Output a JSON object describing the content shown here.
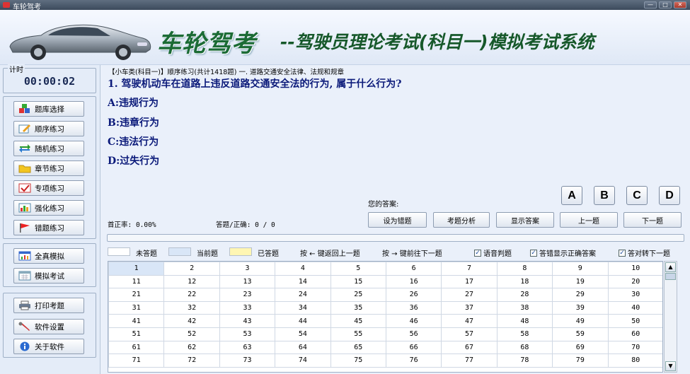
{
  "window": {
    "title": "车轮驾考",
    "controls": [
      "—",
      "□",
      "✕"
    ]
  },
  "banner": {
    "brand": "车轮驾考",
    "subtitle": "--驾驶员理论考试(科目一)模拟考试系统"
  },
  "timer": {
    "label": "计时",
    "value": "00:00:02"
  },
  "sidebar": {
    "group1": [
      {
        "label": "题库选择",
        "icon": "cubes-icon"
      },
      {
        "label": "顺序练习",
        "icon": "pencil-icon"
      },
      {
        "label": "随机练习",
        "icon": "shuffle-arrows-icon"
      },
      {
        "label": "章节练习",
        "icon": "folder-icon"
      },
      {
        "label": "专项练习",
        "icon": "checkmark-icon"
      },
      {
        "label": "强化练习",
        "icon": "bar-chart-icon"
      },
      {
        "label": "错题练习",
        "icon": "flag-icon"
      }
    ],
    "group2": [
      {
        "label": "全真模拟",
        "icon": "chart-window-icon"
      },
      {
        "label": "模拟考试",
        "icon": "calendar-icon"
      }
    ],
    "group3": [
      {
        "label": "打印考题",
        "icon": "printer-icon"
      },
      {
        "label": "软件设置",
        "icon": "wrench-icon"
      },
      {
        "label": "关于软件",
        "icon": "info-icon"
      }
    ]
  },
  "question": {
    "breadcrumb": "【小车类(科目一)】顺序练习(共计1418题) 一. 道路交通安全法律、法规和规章",
    "text": "1. 驾驶机动车在道路上违反道路交通安全法的行为, 属于什么行为?",
    "options": [
      "A:违规行为",
      "B:违章行为",
      "C:违法行为",
      "D:过失行为"
    ]
  },
  "answer": {
    "label": "您的答案:",
    "value": "",
    "buttons": [
      "A",
      "B",
      "C",
      "D"
    ]
  },
  "stats": {
    "accuracy": "首正率: 0.00%",
    "answered": "答题/正确: 0 / 0"
  },
  "actions": [
    "设为错题",
    "考题分析",
    "显示答案",
    "上一题",
    "下一题"
  ],
  "progress": {
    "fraction": 0.0
  },
  "legend": {
    "unanswered": "未答题",
    "current": "当前题",
    "answered": "已答题",
    "hint_left": "按 ← 键返回上一题",
    "hint_right": "按 → 键前往下一题",
    "checks": [
      {
        "label": "语音判题",
        "checked": true
      },
      {
        "label": "答错显示正确答案",
        "checked": true
      },
      {
        "label": "答对转下一题",
        "checked": true
      }
    ]
  },
  "colors": {
    "unanswered": "#ffffff",
    "current": "#d9e6f7",
    "answered": "#fff6b3"
  },
  "grid": {
    "rows": [
      [
        "1",
        "2",
        "3",
        "4",
        "5",
        "6",
        "7",
        "8",
        "9",
        "10"
      ],
      [
        "11",
        "12",
        "13",
        "14",
        "15",
        "16",
        "17",
        "18",
        "19",
        "20"
      ],
      [
        "21",
        "22",
        "23",
        "24",
        "25",
        "26",
        "27",
        "28",
        "29",
        "30"
      ],
      [
        "31",
        "32",
        "33",
        "34",
        "35",
        "36",
        "37",
        "38",
        "39",
        "40"
      ],
      [
        "41",
        "42",
        "43",
        "44",
        "45",
        "46",
        "47",
        "48",
        "49",
        "50"
      ],
      [
        "51",
        "52",
        "53",
        "54",
        "55",
        "56",
        "57",
        "58",
        "59",
        "60"
      ],
      [
        "61",
        "62",
        "63",
        "64",
        "65",
        "66",
        "67",
        "68",
        "69",
        "70"
      ],
      [
        "71",
        "72",
        "73",
        "74",
        "75",
        "76",
        "77",
        "78",
        "79",
        "80"
      ]
    ],
    "current": "1"
  }
}
